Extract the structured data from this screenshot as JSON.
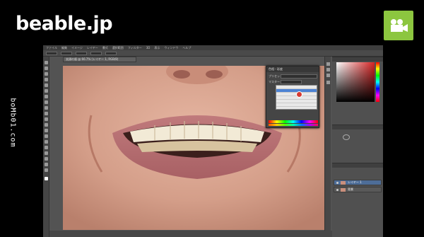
{
  "brand": {
    "logo_text": "beable.jp",
    "side_text": "boMb01.com"
  },
  "app": {
    "menu": [
      "ファイル",
      "編集",
      "イメージ",
      "レイヤー",
      "書式",
      "選択範囲",
      "フィルター",
      "3D",
      "表示",
      "ウィンドウ",
      "ヘルプ"
    ],
    "doc_tab": "笑顔の歯 @ 66.7% (レイヤー 1, RGB/8)",
    "dialog": {
      "title": "色相・彩度",
      "preset_label": "プリセット",
      "channel_label": "マスター"
    },
    "layers": [
      {
        "name": "レイヤー 1",
        "active": true
      },
      {
        "name": "背景",
        "active": false
      }
    ]
  },
  "icons": {
    "camera": "video-camera-icon"
  },
  "colors": {
    "badge": "#8cc63f",
    "accent": "#4d83d4",
    "dialog_marker": "#d73a31"
  }
}
